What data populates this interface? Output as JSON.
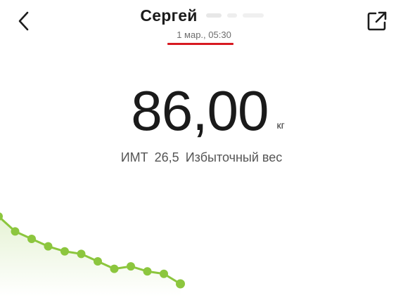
{
  "header": {
    "user_name": "Сергей",
    "date": "1 мар., 05:30",
    "back_icon": "chevron-left-icon",
    "share_icon": "share-external-icon"
  },
  "measurement": {
    "weight": "86,00",
    "unit": "кг",
    "bmi_label": "ИМТ",
    "bmi_value": "26,5",
    "status": "Избыточный вес"
  },
  "colors": {
    "accent_red": "#d71921",
    "trend_green": "#8cc63e"
  },
  "trend": {
    "values": [
      88.0,
      87.4,
      87.1,
      86.8,
      86.6,
      86.5,
      86.2,
      85.9,
      86.0,
      85.8,
      85.7,
      85.3
    ]
  }
}
